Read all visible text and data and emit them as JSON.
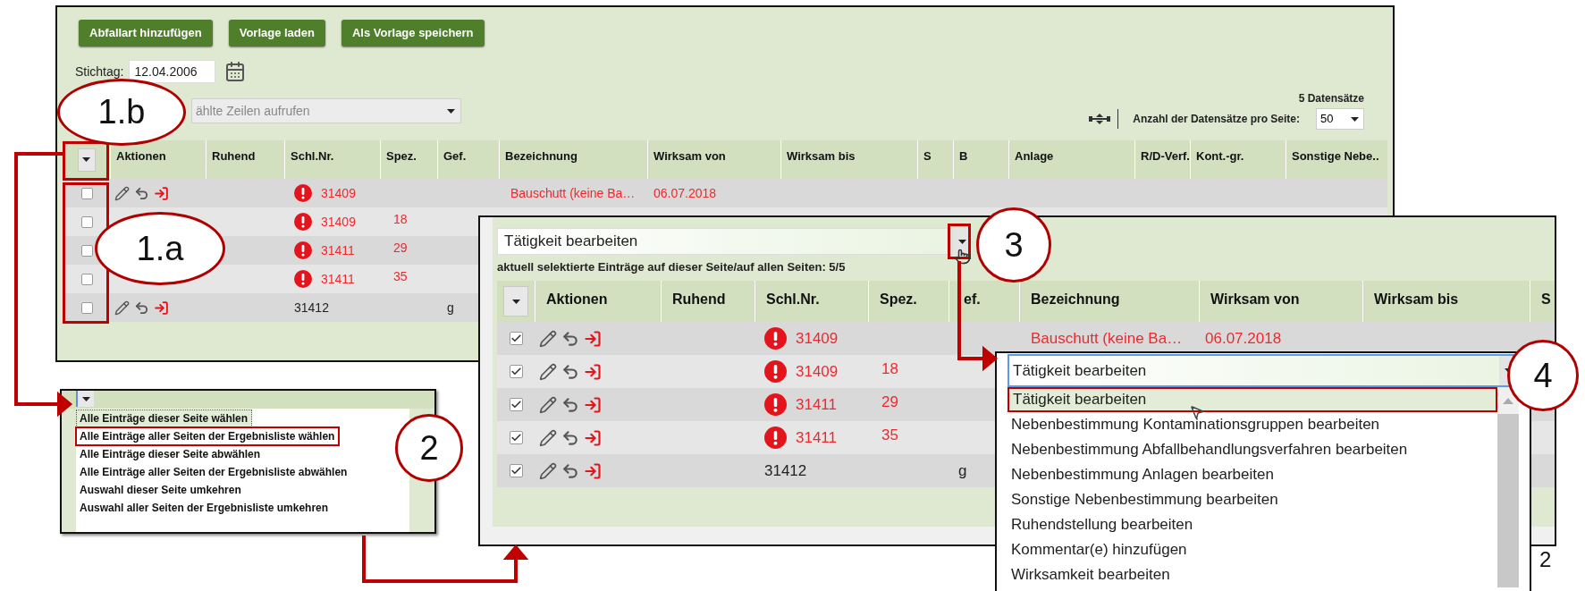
{
  "main_window": {
    "buttons": [
      "Abfallart hinzufügen",
      "Vorlage laden",
      "Als Vorlage speichern"
    ],
    "date_label": "Stichtag:",
    "date_value": "12.04.2006",
    "bulk_action_field": "ählte Zeilen aufrufen",
    "record_count": "5 Datensätze",
    "per_page_label": "Anzahl der Datensätze pro Seite:",
    "per_page_value": "50",
    "columns": [
      "Aktionen",
      "Ruhend",
      "Schl.Nr.",
      "Spez.",
      "Gef.",
      "Bezeichnung",
      "Wirksam von",
      "Wirksam bis",
      "S",
      "B",
      "Anlage",
      "R/D-Verf.",
      "Kont.-gr.",
      "Sonstige Nebe.."
    ],
    "rows": [
      {
        "checked": false,
        "warning": true,
        "key_no": "31409",
        "designation": "Bauschutt (keine Ba…",
        "valid_from": "06.07.2018"
      },
      {
        "checked": false,
        "warning": true,
        "key_no": "31409",
        "spec": "18"
      },
      {
        "checked": false,
        "warning": true,
        "key_no": "31411",
        "spec": "29"
      },
      {
        "checked": false,
        "warning": true,
        "key_no": "31411",
        "spec": "35"
      },
      {
        "checked": false,
        "warning": false,
        "key_no": "31412",
        "haz": "g"
      }
    ]
  },
  "selection_menu": {
    "items": [
      {
        "label": "Alle Einträge dieser Seite wählen",
        "selected": false,
        "focused": true
      },
      {
        "label": "Alle Einträge aller Seiten der Ergebnisliste wählen",
        "selected": true,
        "focused": false
      },
      {
        "label": "Alle Einträge dieser Seite abwählen",
        "selected": false,
        "focused": false
      },
      {
        "label": "Alle Einträge aller Seiten der Ergebnisliste abwählen",
        "selected": false,
        "focused": false
      },
      {
        "label": "Auswahl dieser Seite umkehren",
        "selected": false,
        "focused": false
      },
      {
        "label": "Auswahl aller Seiten der Ergebnisliste umkehren",
        "selected": false,
        "focused": false
      }
    ]
  },
  "edit_window": {
    "action_field": "Tätigkeit bearbeiten",
    "selection_status": "aktuell selektierte Einträge auf dieser Seite/auf allen Seiten: 5/5",
    "columns": [
      "Aktionen",
      "Ruhend",
      "Schl.Nr.",
      "Spez.",
      "ef.",
      "Bezeichnung",
      "Wirksam von",
      "Wirksam bis",
      "S"
    ],
    "rows": [
      {
        "checked": true,
        "warning": true,
        "key_no": "31409",
        "designation": "Bauschutt (keine Ba…",
        "valid_from": "06.07.2018"
      },
      {
        "checked": true,
        "warning": true,
        "key_no": "31409",
        "spec": "18"
      },
      {
        "checked": true,
        "warning": true,
        "key_no": "31411",
        "spec": "29"
      },
      {
        "checked": true,
        "warning": true,
        "key_no": "31411",
        "spec": "35"
      },
      {
        "checked": true,
        "warning": false,
        "key_no": "31412",
        "haz": "g"
      }
    ]
  },
  "action_dropdown": {
    "value": "Tätigkeit bearbeiten",
    "options": [
      {
        "label": "Tätigkeit bearbeiten",
        "selected": true
      },
      {
        "label": "Nebenbestimmung Kontaminationsgruppen bearbeiten",
        "selected": false
      },
      {
        "label": "Nebenbestimmung Abfallbehandlungsverfahren bearbeiten",
        "selected": false
      },
      {
        "label": "Nebenbestimmung Anlagen bearbeiten",
        "selected": false
      },
      {
        "label": "Sonstige Nebenbestimmung bearbeiten",
        "selected": false
      },
      {
        "label": "Ruhendstellung bearbeiten",
        "selected": false
      },
      {
        "label": "Kommentar(e) hinzufügen",
        "selected": false
      },
      {
        "label": "Wirksamkeit bearbeiten",
        "selected": false
      }
    ]
  },
  "callouts": [
    {
      "label": "1.b",
      "kind": "ellipse"
    },
    {
      "label": "1.a",
      "kind": "ellipse"
    },
    {
      "label": "2",
      "kind": "circle"
    },
    {
      "label": "3",
      "kind": "circle"
    },
    {
      "label": "4",
      "kind": "circle"
    }
  ],
  "page_number": "2"
}
